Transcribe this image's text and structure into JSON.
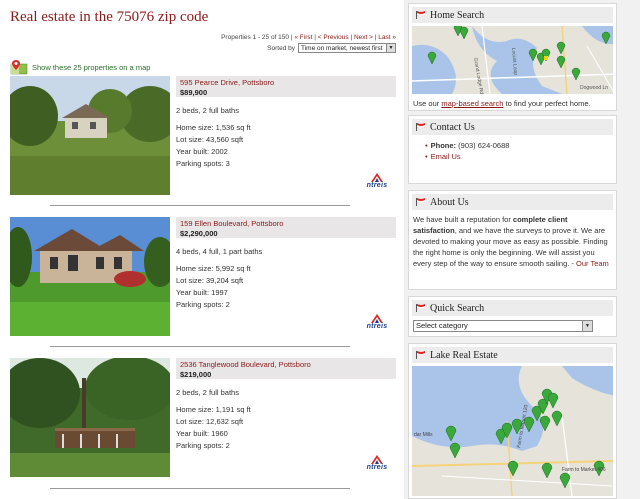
{
  "page": {
    "title": "Real estate in the 75076 zip code",
    "pager": {
      "range": "Properties 1 - 25 of 150",
      "first": "« First",
      "previous": "< Previous",
      "next": "Next >",
      "last": "Last »",
      "sep": "|"
    },
    "sort": {
      "label": "Sorted by",
      "selected": "Time on market, newest first"
    },
    "map_link": "Show these 25 properties on a map",
    "listings": [
      {
        "address": "595 Pearce Drive, Pottsboro",
        "price": "$89,900",
        "beds_baths": "2 beds, 2 full baths",
        "home_size": "Home size: 1,536 sq ft",
        "lot_size": "Lot size: 43,560 sqft",
        "year_built": "Year built: 2002",
        "parking": "Parking spots: 3",
        "logo": "ntreis"
      },
      {
        "address": "159 Ellen Boulevard, Pottsboro",
        "price": "$2,290,000",
        "beds_baths": "4 beds, 4 full, 1 part baths",
        "home_size": "Home size: 5,992 sq ft",
        "lot_size": "Lot size: 39,204 sqft",
        "year_built": "Year built: 1997",
        "parking": "Parking spots: 2",
        "logo": "ntreis"
      },
      {
        "address": "2536 Tanglewood Boulevard, Pottsboro",
        "price": "$219,000",
        "beds_baths": "2 beds, 2 full baths",
        "home_size": "Home size: 1,191 sq ft",
        "lot_size": "Lot size: 12,632 sqft",
        "year_built": "Year built: 1960",
        "parking": "Parking spots: 2",
        "logo": "ntreis"
      }
    ]
  },
  "sidebar": {
    "home_search": {
      "title": "Home Search",
      "text_before": "Use our ",
      "link": "map-based search",
      "text_after": " to find your perfect home.",
      "map_labels": [
        "Grand Lodge Rd",
        "Locust Loop",
        "Dogwood Ln"
      ]
    },
    "contact": {
      "title": "Contact Us",
      "phone_label": "Phone:",
      "phone": "(903) 624-0688",
      "email": "Email Us"
    },
    "about": {
      "title": "About Us",
      "p1": "We have built a reputation for ",
      "p1_bold": "complete client satisfaction",
      "p2": ", and we have the surveys to prove it. We are devoted to making your move as easy as possible. Finding the right home is only the beginning. We will assist you every step of the way to ensure smooth sailing. - ",
      "link": "Our Team"
    },
    "quick_search": {
      "title": "Quick Search",
      "selected": "Select category"
    },
    "lake": {
      "title": "Lake Real Estate",
      "map_labels": [
        "dar Mills",
        "Farm to Market 406",
        "Farm to Market 120"
      ]
    }
  },
  "colors": {
    "accent": "#8b1a1a",
    "link_green": "#2d6e2d",
    "header_bg": "#e8e6e6",
    "sidebar_bg": "#f1f1f1",
    "pin_green": "#3aa83a"
  }
}
